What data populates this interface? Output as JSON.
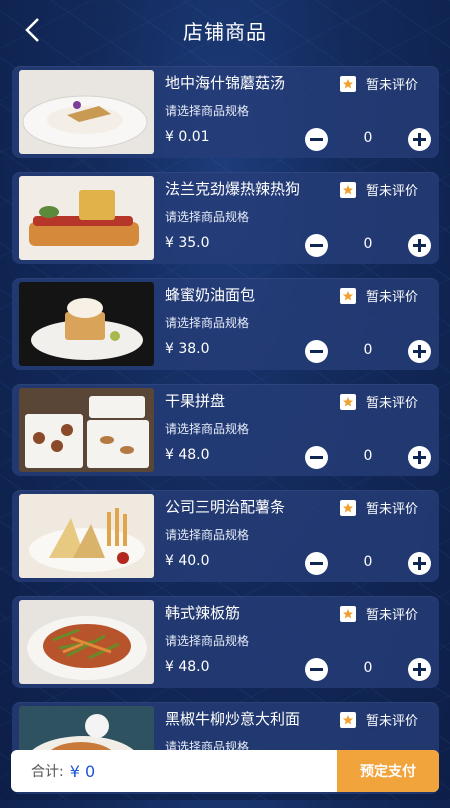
{
  "header": {
    "title": "店铺商品"
  },
  "products": [
    {
      "name": "地中海什锦蘑菇汤",
      "spec": "请选择商品规格",
      "price": "¥ 0.01",
      "qty": "0",
      "rating": "暂未评价"
    },
    {
      "name": "法兰克劲爆热辣热狗",
      "spec": "请选择商品规格",
      "price": "¥ 35.0",
      "qty": "0",
      "rating": "暂未评价"
    },
    {
      "name": "蜂蜜奶油面包",
      "spec": "请选择商品规格",
      "price": "¥ 38.0",
      "qty": "0",
      "rating": "暂未评价"
    },
    {
      "name": "干果拼盘",
      "spec": "请选择商品规格",
      "price": "¥ 48.0",
      "qty": "0",
      "rating": "暂未评价"
    },
    {
      "name": "公司三明治配薯条",
      "spec": "请选择商品规格",
      "price": "¥ 40.0",
      "qty": "0",
      "rating": "暂未评价"
    },
    {
      "name": "韩式辣板筋",
      "spec": "请选择商品规格",
      "price": "¥ 48.0",
      "qty": "0",
      "rating": "暂未评价"
    },
    {
      "name": "黑椒牛柳炒意大利面",
      "spec": "请选择商品规格",
      "price": "",
      "qty": "",
      "rating": "暂未评价"
    }
  ],
  "footer": {
    "total_label": "合计:",
    "total_value": "¥ 0",
    "pay_label": "预定支付"
  },
  "colors": {
    "accent": "#f2a43c",
    "total": "#1b57d6",
    "card": "#263e78"
  },
  "icons": {
    "back": "chevron-left-icon",
    "rating": "star-icon",
    "minus": "minus-circle-icon",
    "plus": "plus-circle-icon"
  }
}
